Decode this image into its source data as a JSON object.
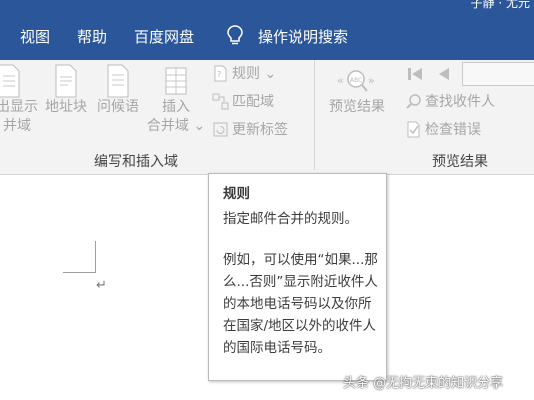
{
  "titlebar": {
    "user_fragment": "子静 · 尤元"
  },
  "menu": {
    "items": [
      "视图",
      "帮助",
      "百度网盘"
    ],
    "search_label": "操作说明搜索"
  },
  "ribbon": {
    "group1": {
      "buttons": [
        {
          "line1": "出显示",
          "line2": "并域"
        },
        {
          "line1": "地址块"
        },
        {
          "line1": "问候语"
        },
        {
          "line1": "插入",
          "line2": "合并域 ⌄"
        }
      ],
      "small_buttons": [
        "规则 ⌄",
        "匹配域",
        "更新标签"
      ],
      "label": "编写和插入域"
    },
    "group2": {
      "preview_button": "预览结果",
      "small_buttons": [
        "查找收件人",
        "检查错误"
      ],
      "label": "预览结果"
    }
  },
  "tooltip": {
    "title": "规则",
    "description": "指定邮件合并的规则。",
    "example": "例如，可以使用“如果...那么...否则”显示附近收件人的本地电话号码以及你所在国家/地区以外的收件人的国际电话号码。"
  },
  "document": {
    "paragraph_mark": "↵"
  },
  "watermark": "头条 @无拘无束的知识分享",
  "colors": {
    "accent": "#2b579a",
    "ribbon_bg": "#f3f3f3",
    "disabled_text": "#a6a6a6"
  }
}
